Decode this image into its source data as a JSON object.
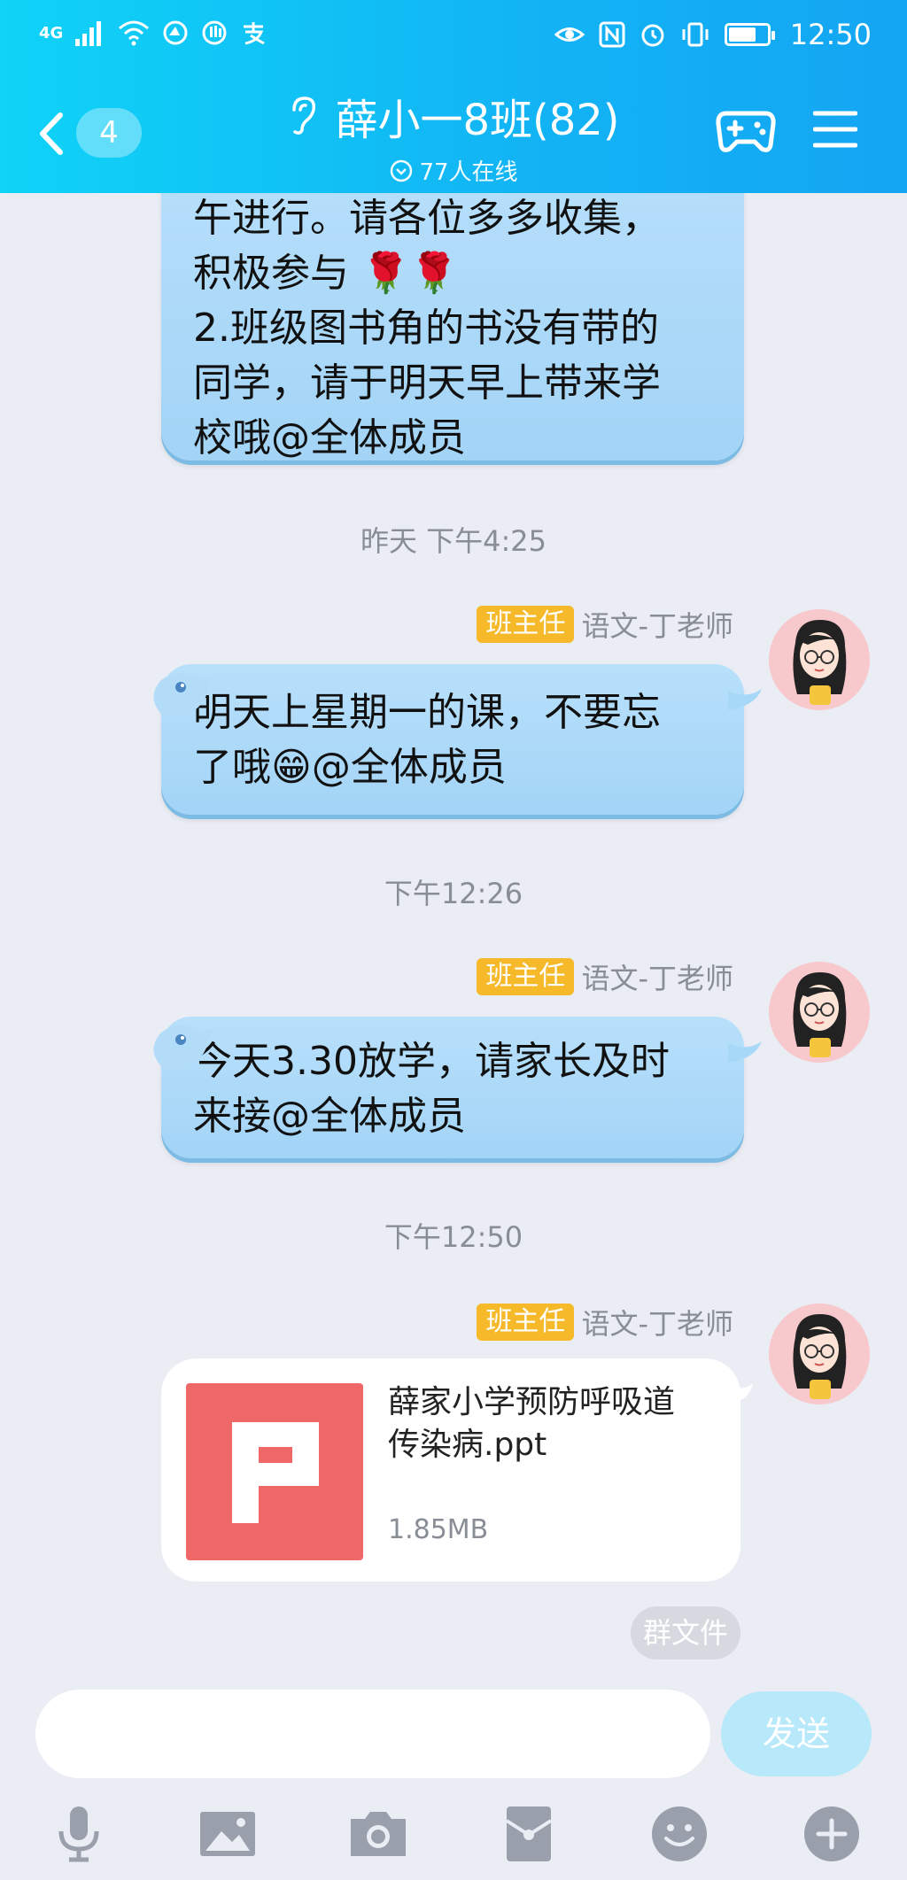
{
  "status_bar": {
    "network": "4G",
    "time": "12:50",
    "battery_level": 0.65
  },
  "header": {
    "back_count": "4",
    "title": "薛小一8班(82)",
    "online_text": "77人在线"
  },
  "messages": [
    {
      "lines": [
        "午进行。请各位多多收集，",
        "积极参与 🌹🌹",
        "2.班级图书角的书没有带的",
        "同学，请于明天早上带来学",
        "校哦@全体成员"
      ]
    }
  ],
  "timestamps": [
    "昨天 下午4:25",
    "下午12:26",
    "下午12:50"
  ],
  "sender": {
    "role": "班主任",
    "name": "语文-丁老师"
  },
  "msg2": {
    "lines": [
      "明天上星期一的课，不要忘",
      "了哦😁@全体成员"
    ]
  },
  "msg3": {
    "lines": [
      "今天3.30放学，请家长及时",
      "来接@全体成员"
    ]
  },
  "file": {
    "name_lines": [
      "薛家小学预防呼吸道",
      "传染病.ppt"
    ],
    "size": "1.85MB",
    "icon": "ppt-file-icon",
    "tag": "群文件"
  },
  "input": {
    "placeholder": "",
    "send_label": "发送"
  },
  "toolbar_icons": [
    "microphone-icon",
    "image-icon",
    "camera-icon",
    "red-packet-icon",
    "emoji-icon",
    "plus-icon"
  ],
  "colors": {
    "header_start": "#0fd3f7",
    "header_end": "#14a5f3",
    "bubble": "#a9d8f8",
    "role_badge": "#f5b92a",
    "ppt": "#f06767",
    "background": "#ebedf5"
  }
}
